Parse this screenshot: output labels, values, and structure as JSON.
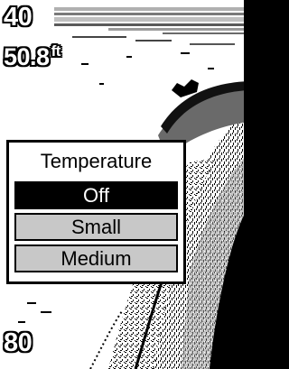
{
  "sonar": {
    "top_depth": "40",
    "current_depth": "50.8",
    "current_depth_unit": "ft",
    "bottom_depth": "80"
  },
  "menu": {
    "title": "Temperature",
    "items": [
      {
        "label": "Off",
        "selected": true
      },
      {
        "label": "Small",
        "selected": false
      },
      {
        "label": "Medium",
        "selected": false
      }
    ]
  },
  "colors": {
    "highlight_bg": "#000000",
    "highlight_text": "#ffffff",
    "item_bg": "#c8c8c8",
    "sonar_background": "#ffffff"
  }
}
